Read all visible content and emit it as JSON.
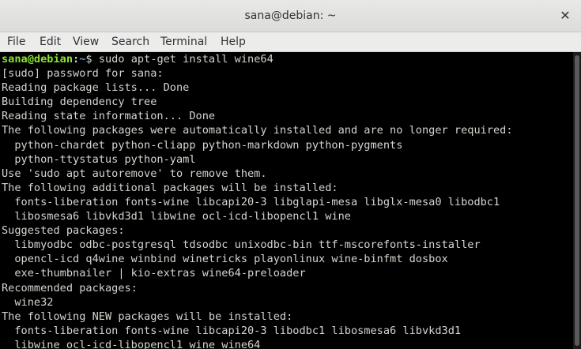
{
  "window": {
    "title": "sana@debian: ~",
    "close_icon": "✕"
  },
  "menu": [
    "File",
    "Edit",
    "View",
    "Search",
    "Terminal",
    "Help"
  ],
  "prompt": {
    "user_host": "sana@debian",
    "sep": ":",
    "path": "~",
    "symbol": "$ ",
    "command": "sudo apt-get install wine64"
  },
  "output": [
    "[sudo] password for sana:",
    "Reading package lists... Done",
    "Building dependency tree",
    "Reading state information... Done",
    "The following packages were automatically installed and are no longer required:",
    "  python-chardet python-cliapp python-markdown python-pygments",
    "  python-ttystatus python-yaml",
    "Use 'sudo apt autoremove' to remove them.",
    "The following additional packages will be installed:",
    "  fonts-liberation fonts-wine libcapi20-3 libglapi-mesa libglx-mesa0 libodbc1",
    "  libosmesa6 libvkd3d1 libwine ocl-icd-libopencl1 wine",
    "Suggested packages:",
    "  libmyodbc odbc-postgresql tdsodbc unixodbc-bin ttf-mscorefonts-installer",
    "  opencl-icd q4wine winbind winetricks playonlinux wine-binfmt dosbox",
    "  exe-thumbnailer | kio-extras wine64-preloader",
    "Recommended packages:",
    "  wine32",
    "The following NEW packages will be installed:",
    "  fonts-liberation fonts-wine libcapi20-3 libodbc1 libosmesa6 libvkd3d1",
    "  libwine ocl-icd-libopencl1 wine wine64"
  ],
  "colors": {
    "prompt_user": "#8ae234",
    "prompt_path": "#729fcf",
    "text": "#d3d7cf",
    "background": "#000000"
  }
}
